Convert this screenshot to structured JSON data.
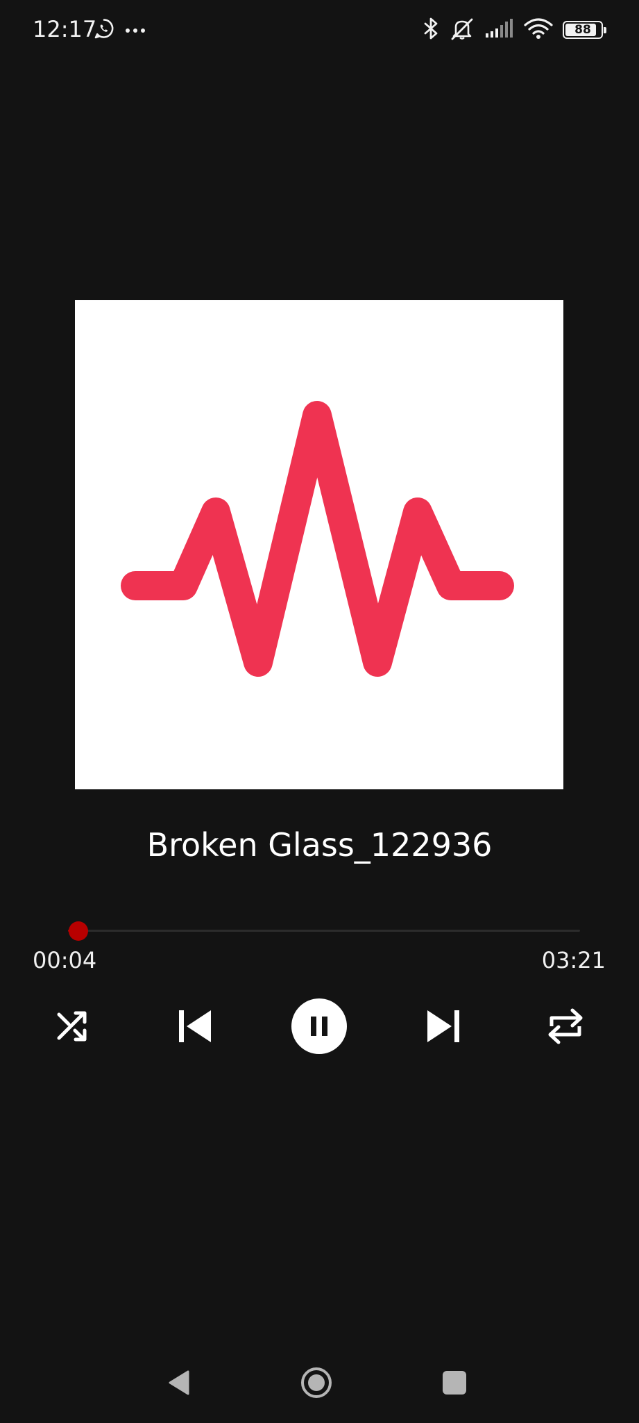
{
  "status_bar": {
    "time": "12:17",
    "battery_level": "88",
    "icons": [
      "whatsapp-icon",
      "more-dots-icon",
      "bluetooth-icon",
      "silent-mode-icon",
      "signal-icon",
      "wifi-icon",
      "battery-icon"
    ]
  },
  "track": {
    "title": "Broken Glass_122936",
    "elapsed": "00:04",
    "duration": "03:21",
    "progress_fraction": 0.02
  },
  "player": {
    "state": "playing",
    "controls": [
      "shuffle-icon",
      "previous-icon",
      "pause-icon",
      "next-icon",
      "repeat-icon"
    ]
  },
  "colors": {
    "background": "#131313",
    "accent_waveform": "#ef3351",
    "seek_thumb": "#b80000",
    "artwork_background": "#ffffff"
  },
  "nav_bar": {
    "buttons": [
      "back-icon",
      "home-icon",
      "recents-icon"
    ]
  }
}
